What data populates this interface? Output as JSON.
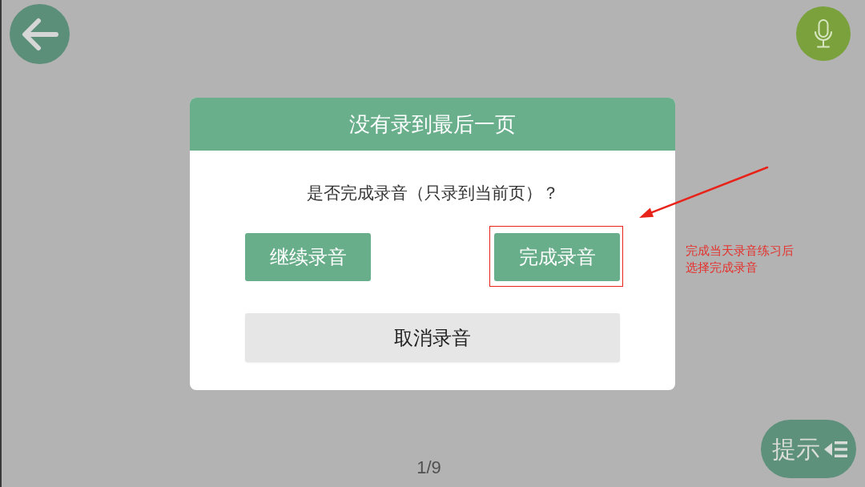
{
  "dialog": {
    "title": "没有录到最后一页",
    "message": "是否完成录音（只录到当前页）？",
    "buttons": [
      {
        "label": "继续录音",
        "kind": "primary",
        "highlighted": false
      },
      {
        "label": "完成录音",
        "kind": "primary",
        "highlighted": true
      },
      {
        "label": "取消录音",
        "kind": "secondary",
        "highlighted": false
      }
    ]
  },
  "page_indicator": "1/9",
  "hint_button": {
    "label": "提示"
  },
  "annotation": {
    "note": "完成当天录音练习后选择完成录音"
  }
}
